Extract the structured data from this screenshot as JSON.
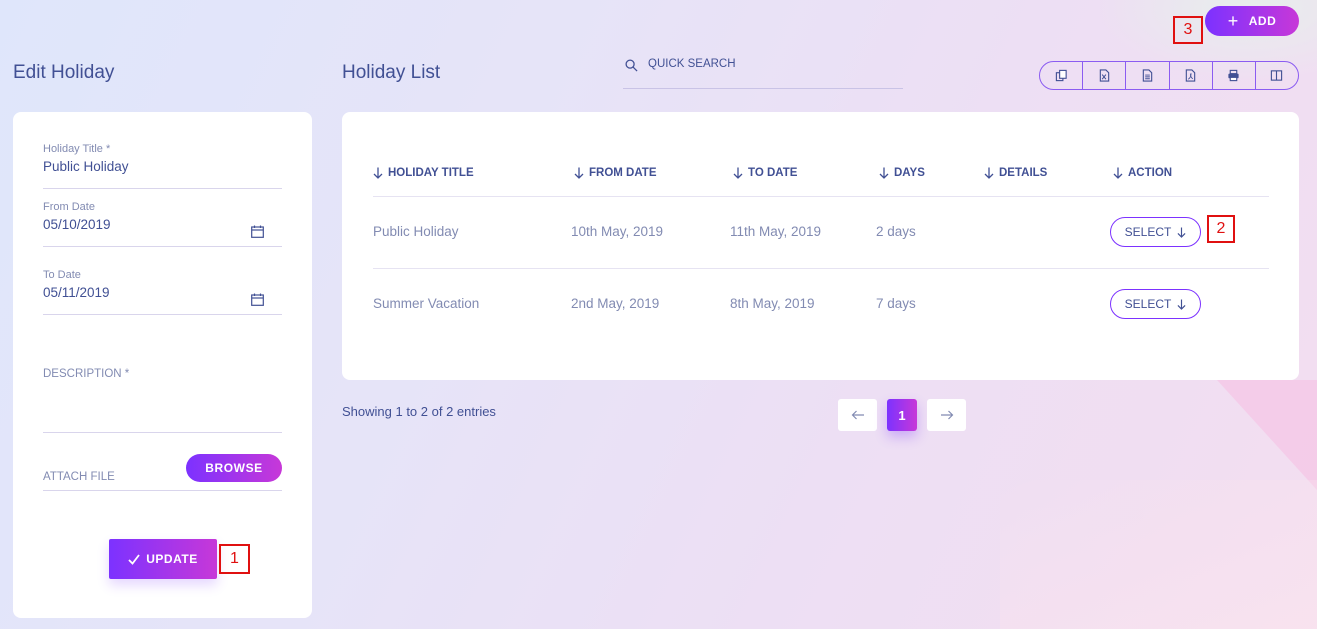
{
  "header": {
    "add_label": "ADD",
    "add_icon": "plus-icon",
    "search_placeholder": "QUICK SEARCH"
  },
  "markers": [
    "1",
    "2",
    "3"
  ],
  "edit_panel": {
    "title": "Edit Holiday",
    "holiday_title_label": "Holiday Title *",
    "holiday_title_value": "Public Holiday",
    "from_date_label": "From Date",
    "from_date_value": "05/10/2019",
    "to_date_label": "To Date",
    "to_date_value": "05/11/2019",
    "description_label": "DESCRIPTION *",
    "attach_label": "ATTACH FILE",
    "browse_label": "BROWSE",
    "update_label": "UPDATE"
  },
  "list_panel": {
    "title": "Holiday List",
    "export_icons": [
      "copy-icon",
      "excel-icon",
      "csv-icon",
      "pdf-icon",
      "print-icon",
      "columns-icon"
    ],
    "columns": [
      "HOLIDAY TITLE",
      "FROM DATE",
      "TO DATE",
      "DAYS",
      "DETAILS",
      "ACTION"
    ],
    "rows": [
      {
        "title": "Public Holiday",
        "from": "10th May, 2019",
        "to": "11th May, 2019",
        "days": "2 days",
        "details": "",
        "action": "SELECT"
      },
      {
        "title": "Summer Vacation",
        "from": "2nd May, 2019",
        "to": "8th May, 2019",
        "days": "7 days",
        "details": "",
        "action": "SELECT"
      }
    ],
    "entries_text": "Showing 1 to 2 of 2 entries",
    "current_page": "1"
  },
  "colors": {
    "accent_start": "#7c32ff",
    "accent_end": "#c738d8",
    "text_primary": "#415094",
    "text_muted": "#828bb2",
    "marker": "#e01010"
  }
}
